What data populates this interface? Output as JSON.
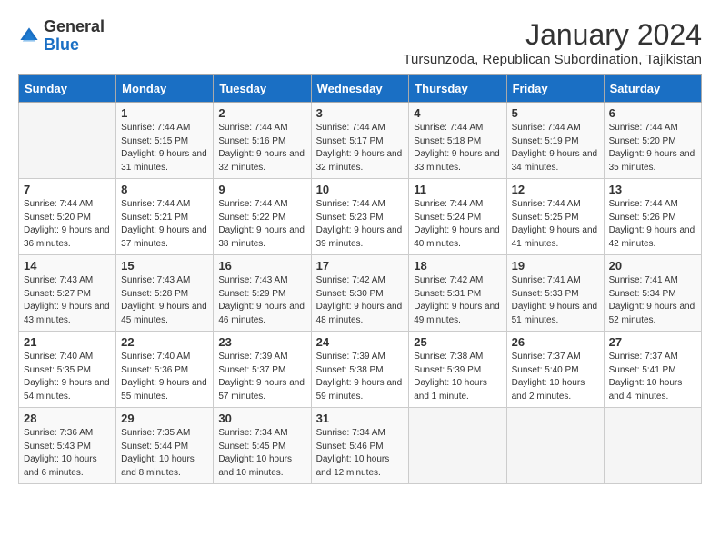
{
  "header": {
    "logo_line1": "General",
    "logo_line2": "Blue",
    "month": "January 2024",
    "location": "Tursunzoda, Republican Subordination, Tajikistan"
  },
  "days_of_week": [
    "Sunday",
    "Monday",
    "Tuesday",
    "Wednesday",
    "Thursday",
    "Friday",
    "Saturday"
  ],
  "weeks": [
    [
      {
        "day": null,
        "content": null
      },
      {
        "day": "1",
        "content": "Sunrise: 7:44 AM\nSunset: 5:15 PM\nDaylight: 9 hours and 31 minutes."
      },
      {
        "day": "2",
        "content": "Sunrise: 7:44 AM\nSunset: 5:16 PM\nDaylight: 9 hours and 32 minutes."
      },
      {
        "day": "3",
        "content": "Sunrise: 7:44 AM\nSunset: 5:17 PM\nDaylight: 9 hours and 32 minutes."
      },
      {
        "day": "4",
        "content": "Sunrise: 7:44 AM\nSunset: 5:18 PM\nDaylight: 9 hours and 33 minutes."
      },
      {
        "day": "5",
        "content": "Sunrise: 7:44 AM\nSunset: 5:19 PM\nDaylight: 9 hours and 34 minutes."
      },
      {
        "day": "6",
        "content": "Sunrise: 7:44 AM\nSunset: 5:20 PM\nDaylight: 9 hours and 35 minutes."
      }
    ],
    [
      {
        "day": "7",
        "content": "Sunrise: 7:44 AM\nSunset: 5:20 PM\nDaylight: 9 hours and 36 minutes."
      },
      {
        "day": "8",
        "content": "Sunrise: 7:44 AM\nSunset: 5:21 PM\nDaylight: 9 hours and 37 minutes."
      },
      {
        "day": "9",
        "content": "Sunrise: 7:44 AM\nSunset: 5:22 PM\nDaylight: 9 hours and 38 minutes."
      },
      {
        "day": "10",
        "content": "Sunrise: 7:44 AM\nSunset: 5:23 PM\nDaylight: 9 hours and 39 minutes."
      },
      {
        "day": "11",
        "content": "Sunrise: 7:44 AM\nSunset: 5:24 PM\nDaylight: 9 hours and 40 minutes."
      },
      {
        "day": "12",
        "content": "Sunrise: 7:44 AM\nSunset: 5:25 PM\nDaylight: 9 hours and 41 minutes."
      },
      {
        "day": "13",
        "content": "Sunrise: 7:44 AM\nSunset: 5:26 PM\nDaylight: 9 hours and 42 minutes."
      }
    ],
    [
      {
        "day": "14",
        "content": "Sunrise: 7:43 AM\nSunset: 5:27 PM\nDaylight: 9 hours and 43 minutes."
      },
      {
        "day": "15",
        "content": "Sunrise: 7:43 AM\nSunset: 5:28 PM\nDaylight: 9 hours and 45 minutes."
      },
      {
        "day": "16",
        "content": "Sunrise: 7:43 AM\nSunset: 5:29 PM\nDaylight: 9 hours and 46 minutes."
      },
      {
        "day": "17",
        "content": "Sunrise: 7:42 AM\nSunset: 5:30 PM\nDaylight: 9 hours and 48 minutes."
      },
      {
        "day": "18",
        "content": "Sunrise: 7:42 AM\nSunset: 5:31 PM\nDaylight: 9 hours and 49 minutes."
      },
      {
        "day": "19",
        "content": "Sunrise: 7:41 AM\nSunset: 5:33 PM\nDaylight: 9 hours and 51 minutes."
      },
      {
        "day": "20",
        "content": "Sunrise: 7:41 AM\nSunset: 5:34 PM\nDaylight: 9 hours and 52 minutes."
      }
    ],
    [
      {
        "day": "21",
        "content": "Sunrise: 7:40 AM\nSunset: 5:35 PM\nDaylight: 9 hours and 54 minutes."
      },
      {
        "day": "22",
        "content": "Sunrise: 7:40 AM\nSunset: 5:36 PM\nDaylight: 9 hours and 55 minutes."
      },
      {
        "day": "23",
        "content": "Sunrise: 7:39 AM\nSunset: 5:37 PM\nDaylight: 9 hours and 57 minutes."
      },
      {
        "day": "24",
        "content": "Sunrise: 7:39 AM\nSunset: 5:38 PM\nDaylight: 9 hours and 59 minutes."
      },
      {
        "day": "25",
        "content": "Sunrise: 7:38 AM\nSunset: 5:39 PM\nDaylight: 10 hours and 1 minute."
      },
      {
        "day": "26",
        "content": "Sunrise: 7:37 AM\nSunset: 5:40 PM\nDaylight: 10 hours and 2 minutes."
      },
      {
        "day": "27",
        "content": "Sunrise: 7:37 AM\nSunset: 5:41 PM\nDaylight: 10 hours and 4 minutes."
      }
    ],
    [
      {
        "day": "28",
        "content": "Sunrise: 7:36 AM\nSunset: 5:43 PM\nDaylight: 10 hours and 6 minutes."
      },
      {
        "day": "29",
        "content": "Sunrise: 7:35 AM\nSunset: 5:44 PM\nDaylight: 10 hours and 8 minutes."
      },
      {
        "day": "30",
        "content": "Sunrise: 7:34 AM\nSunset: 5:45 PM\nDaylight: 10 hours and 10 minutes."
      },
      {
        "day": "31",
        "content": "Sunrise: 7:34 AM\nSunset: 5:46 PM\nDaylight: 10 hours and 12 minutes."
      },
      {
        "day": null,
        "content": null
      },
      {
        "day": null,
        "content": null
      },
      {
        "day": null,
        "content": null
      }
    ]
  ]
}
